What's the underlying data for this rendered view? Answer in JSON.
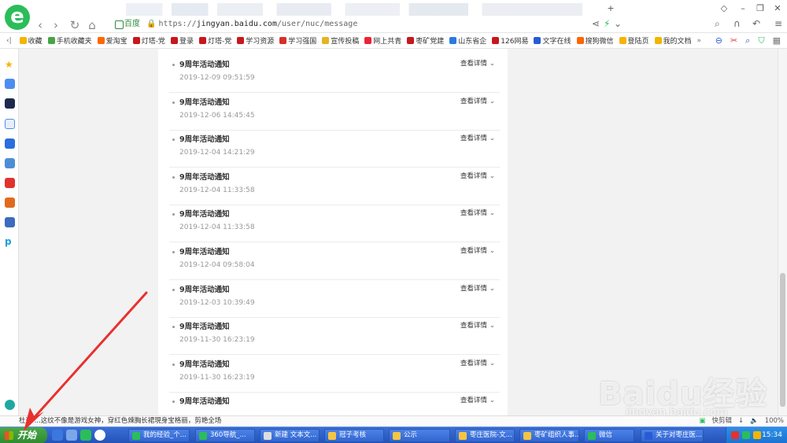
{
  "browser": {
    "address": {
      "site_label": "百度",
      "scheme": "https://",
      "host": "jingyan.baidu.com",
      "path": "/user/nuc/message"
    }
  },
  "bookmarks": [
    {
      "label": "收藏",
      "color": "#f5b400"
    },
    {
      "label": "手机收藏夹",
      "color": "#47a447"
    },
    {
      "label": "爱淘宝",
      "color": "#f60"
    },
    {
      "label": "灯塔-党",
      "color": "#c8161d"
    },
    {
      "label": "登录",
      "color": "#c8161d"
    },
    {
      "label": "灯塔-党",
      "color": "#c8161d"
    },
    {
      "label": "学习资源",
      "color": "#c8161d"
    },
    {
      "label": "学习强国",
      "color": "#d6302b"
    },
    {
      "label": "宣传投稿",
      "color": "#e6b422"
    },
    {
      "label": "网上共青",
      "color": "#e23"
    },
    {
      "label": "枣矿党建",
      "color": "#c8161d"
    },
    {
      "label": "山东省企",
      "color": "#2a7ae2"
    },
    {
      "label": "126网易",
      "color": "#c8161d"
    },
    {
      "label": "文字在线",
      "color": "#2a5bd6"
    },
    {
      "label": "搜狗微信",
      "color": "#f60"
    },
    {
      "label": "登陆页",
      "color": "#f5b400"
    },
    {
      "label": "我的文档",
      "color": "#f5b400"
    }
  ],
  "messages": [
    {
      "title": "9周年活动通知",
      "date": "2019-12-09 09:51:59",
      "action": "查看详情"
    },
    {
      "title": "9周年活动通知",
      "date": "2019-12-06 14:45:45",
      "action": "查看详情"
    },
    {
      "title": "9周年活动通知",
      "date": "2019-12-04 14:21:29",
      "action": "查看详情"
    },
    {
      "title": "9周年活动通知",
      "date": "2019-12-04 11:33:58",
      "action": "查看详情"
    },
    {
      "title": "9周年活动通知",
      "date": "2019-12-04 11:33:58",
      "action": "查看详情"
    },
    {
      "title": "9周年活动通知",
      "date": "2019-12-04 09:58:04",
      "action": "查看详情"
    },
    {
      "title": "9周年活动通知",
      "date": "2019-12-03 10:39:49",
      "action": "查看详情"
    },
    {
      "title": "9周年活动通知",
      "date": "2019-11-30 16:23:19",
      "action": "查看详情"
    },
    {
      "title": "9周年活动通知",
      "date": "2019-11-30 16:23:19",
      "action": "查看详情"
    },
    {
      "title": "9周年活动通知",
      "date": "",
      "action": "查看详情"
    }
  ],
  "statusbar": {
    "news": "杜达  ...这纹不像是游戏女神，穿红色辣胸长裙現身宝格丽，剪艳全场",
    "right_label": "快剪辑",
    "zoom": "100%"
  },
  "watermark": {
    "brand": "Baidu经验",
    "url": "jingyan.baidu.com"
  },
  "taskbar": {
    "start_label": "开始",
    "tasks": [
      {
        "label": "我的经验_个...",
        "color": "#2bbd5a"
      },
      {
        "label": "360导航_...",
        "color": "#2bbd5a"
      },
      {
        "label": "新建 文本文...",
        "color": "#ddd"
      },
      {
        "label": "冠子考核",
        "color": "#f5c542"
      },
      {
        "label": "公示",
        "color": "#f5c542"
      },
      {
        "label": "枣庄医院-文...",
        "color": "#f5c542"
      },
      {
        "label": "枣矿组织人事...",
        "color": "#f5c542"
      },
      {
        "label": "微信",
        "color": "#2bbd5a"
      },
      {
        "label": "关于对枣庄医...",
        "color": "#2a5bd6"
      }
    ],
    "clock": "15:34"
  }
}
